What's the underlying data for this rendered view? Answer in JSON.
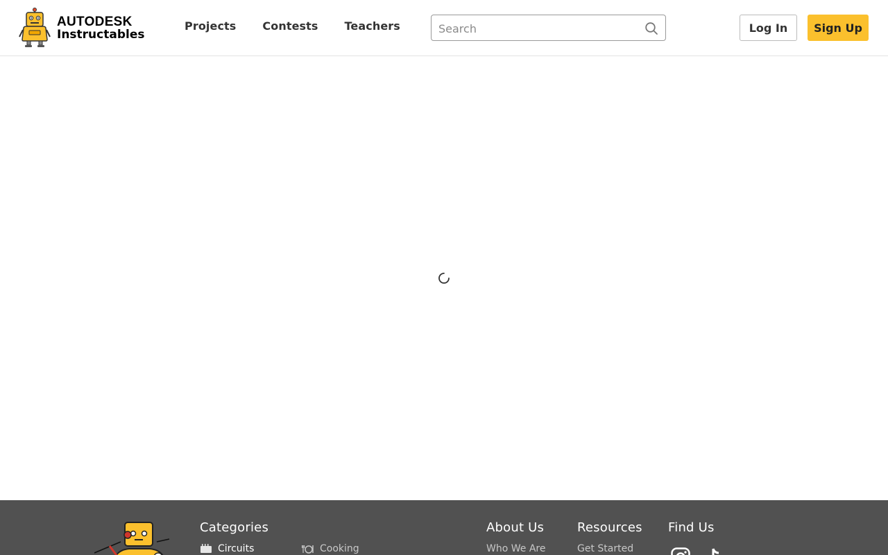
{
  "header": {
    "brand": "AUTODESK",
    "product": "Instructables",
    "nav": [
      "Projects",
      "Contests",
      "Teachers"
    ],
    "search_placeholder": "Search",
    "login_label": "Log In",
    "signup_label": "Sign Up"
  },
  "colors": {
    "accent": "#fbc02d",
    "footer_bg": "#515151"
  },
  "main": {
    "loading": true
  },
  "footer": {
    "categories": {
      "heading": "Categories",
      "items": [
        "Circuits",
        "Cooking"
      ]
    },
    "about": {
      "heading": "About Us",
      "items": [
        "Who We Are"
      ]
    },
    "resources": {
      "heading": "Resources",
      "items": [
        "Get Started"
      ]
    },
    "find_us": {
      "heading": "Find Us",
      "icons": [
        "instagram-icon",
        "tiktok-icon"
      ]
    }
  }
}
